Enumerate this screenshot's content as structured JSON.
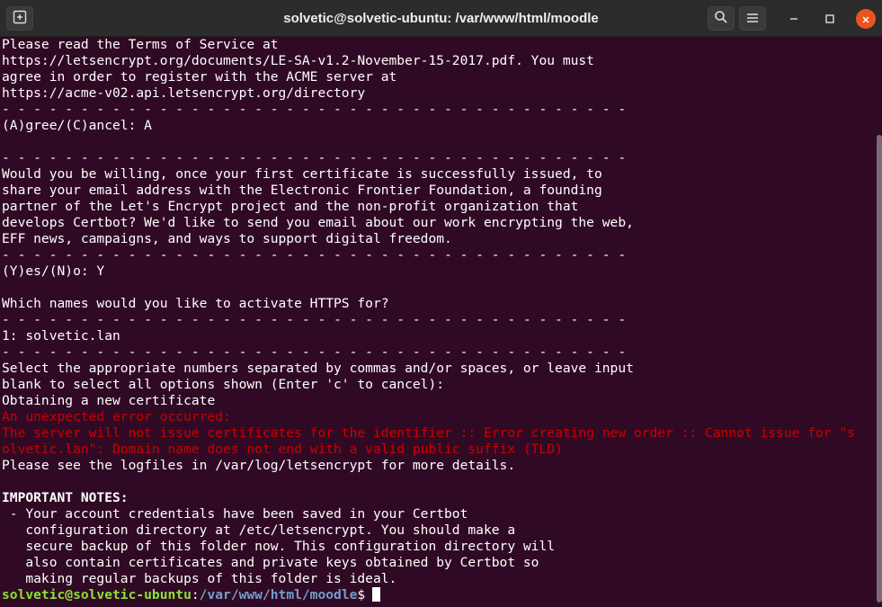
{
  "window": {
    "title": "solvetic@solvetic-ubuntu: /var/www/html/moodle",
    "icons": [
      "new-tab-icon",
      "search-icon",
      "hamburger-menu-icon",
      "minimize-icon",
      "maximize-icon",
      "close-icon"
    ]
  },
  "colors": {
    "background": "#300a24",
    "text": "#ffffff",
    "error": "#cc0000",
    "prompt_user": "#8ae234",
    "prompt_path": "#729fcf",
    "close_button": "#e95420"
  },
  "terminal": {
    "lines": [
      "Please read the Terms of Service at",
      "https://letsencrypt.org/documents/LE-SA-v1.2-November-15-2017.pdf. You must",
      "agree in order to register with the ACME server at",
      "https://acme-v02.api.letsencrypt.org/directory",
      "- - - - - - - - - - - - - - - - - - - - - - - - - - - - - - - - - - - - - - - -",
      "(A)gree/(C)ancel: A",
      "",
      "- - - - - - - - - - - - - - - - - - - - - - - - - - - - - - - - - - - - - - - -",
      "Would you be willing, once your first certificate is successfully issued, to",
      "share your email address with the Electronic Frontier Foundation, a founding",
      "partner of the Let's Encrypt project and the non-profit organization that",
      "develops Certbot? We'd like to send you email about our work encrypting the web,",
      "EFF news, campaigns, and ways to support digital freedom.",
      "- - - - - - - - - - - - - - - - - - - - - - - - - - - - - - - - - - - - - - - -",
      "(Y)es/(N)o: Y",
      "",
      "Which names would you like to activate HTTPS for?",
      "- - - - - - - - - - - - - - - - - - - - - - - - - - - - - - - - - - - - - - - -",
      "1: solvetic.lan",
      "- - - - - - - - - - - - - - - - - - - - - - - - - - - - - - - - - - - - - - - -",
      "Select the appropriate numbers separated by commas and/or spaces, or leave input",
      "blank to select all options shown (Enter 'c' to cancel):",
      "Obtaining a new certificate",
      "An unexpected error occurred:",
      "The server will not issue certificates for the identifier :: Error creating new order :: Cannot issue for \"s",
      "olvetic.lan\": Domain name does not end with a valid public suffix (TLD)",
      "Please see the logfiles in /var/log/letsencrypt for more details.",
      "",
      "IMPORTANT NOTES:",
      " - Your account credentials have been saved in your Certbot",
      "   configuration directory at /etc/letsencrypt. You should make a",
      "   secure backup of this folder now. This configuration directory will",
      "   also contain certificates and private keys obtained by Certbot so",
      "   making regular backups of this folder is ideal."
    ],
    "prompt": {
      "user_host": "solvetic@solvetic-ubuntu",
      "separator": ":",
      "path": "/var/www/html/moodle",
      "symbol": "$"
    }
  }
}
